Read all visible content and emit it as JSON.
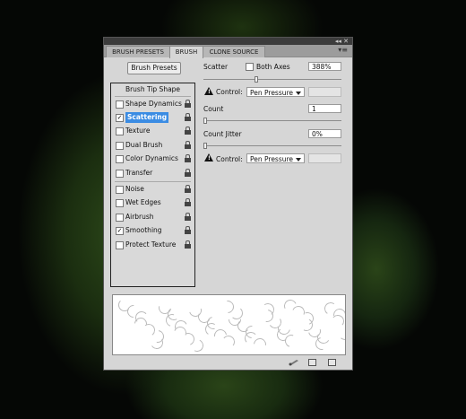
{
  "titlebar": {
    "controls": "◂◂ ✕"
  },
  "tabs": [
    {
      "label": "BRUSH PRESETS"
    },
    {
      "label": "BRUSH"
    },
    {
      "label": "CLONE SOURCE"
    }
  ],
  "tab_menu": "▾≡",
  "brush_presets_button": "Brush Presets",
  "list": {
    "header": "Brush Tip Shape",
    "items": [
      {
        "label": "Shape Dynamics",
        "checked": false
      },
      {
        "label": "Scattering",
        "checked": true,
        "selected": true
      },
      {
        "label": "Texture",
        "checked": false
      },
      {
        "label": "Dual Brush",
        "checked": false
      },
      {
        "label": "Color Dynamics",
        "checked": false
      },
      {
        "label": "Transfer",
        "checked": false
      },
      {
        "label": "Noise",
        "checked": false
      },
      {
        "label": "Wet Edges",
        "checked": false
      },
      {
        "label": "Airbrush",
        "checked": false
      },
      {
        "label": "Smoothing",
        "checked": true
      },
      {
        "label": "Protect Texture",
        "checked": false
      }
    ]
  },
  "scatter": {
    "label": "Scatter",
    "both_axes_label": "Both Axes",
    "value": "388%",
    "control_label": "Control:",
    "control_value": "Pen Pressure",
    "slider_level": 0.38
  },
  "count": {
    "label": "Count",
    "value": "1",
    "slider_level": 0.0
  },
  "count_jitter": {
    "label": "Count Jitter",
    "value": "0%",
    "control_label": "Control:",
    "control_value": "Pen Pressure",
    "slider_level": 0.0
  },
  "checkmark": "✓",
  "warning_glyph": "!"
}
